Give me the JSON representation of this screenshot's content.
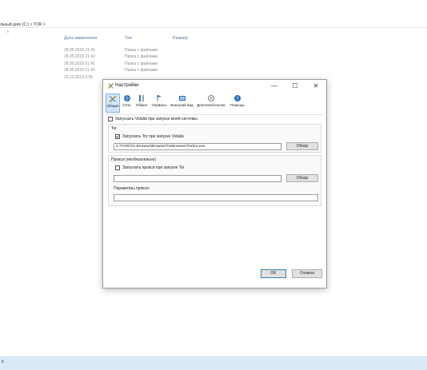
{
  "explorer": {
    "breadcrumb": "льный диск (C:)  >  TOR  >",
    "columns": {
      "date": "Дата изменения",
      "type": "Тип",
      "size": "Размер"
    },
    "rows": [
      {
        "date": "28.05.2019 21:41",
        "type": "Папка с файлами"
      },
      {
        "date": "28.05.2019 21:43",
        "type": "Папка с файлами"
      },
      {
        "date": "28.05.2019 21:41",
        "type": "Папка с файлами"
      },
      {
        "date": "28.05.2019 21:42",
        "type": "Папка с файлами"
      },
      {
        "date": "20.12.2013 0:05",
        "type": ""
      }
    ],
    "taskbar_item": "b"
  },
  "dialog": {
    "title": "Настройки",
    "window_buttons": {
      "minimize": "—",
      "maximize": "☐",
      "close": "✕"
    },
    "tabs": [
      {
        "label": "Общие",
        "icon": "general-icon",
        "color": "#c08a2c"
      },
      {
        "label": "Сеть",
        "icon": "network-icon",
        "color": "#2a6fb8"
      },
      {
        "label": "Обмен",
        "icon": "exchange-icon",
        "color": "#4d6e9b"
      },
      {
        "label": "Сервисы",
        "icon": "services-icon",
        "color": "#2a6fb8"
      },
      {
        "label": "Внешний вид",
        "icon": "appearance-icon",
        "color": "#2e6ebc"
      },
      {
        "label": "Дополнительное",
        "icon": "advanced-icon",
        "color": "#8e8e8e"
      },
      {
        "label": "Помощь",
        "icon": "help-icon",
        "color": "#2a6fb8"
      }
    ],
    "selected_tab": "Общие",
    "start_with_system": {
      "label": "Запускать Vidalia при запуске моей системы",
      "checked": false
    },
    "tor_group": {
      "title": "Tor",
      "start_tor": {
        "label": "Запускать Tor при запуске Vidalia",
        "checked": true
      },
      "path": "C:\\TOR\\Tor Browser\\Browser\\TorBrowser\\Tor\\tor.exe",
      "browse": "Обзор"
    },
    "proxy_group": {
      "title": "Прокси (необязательно)",
      "start_proxy": {
        "label": "Запускать прокси при запуске Tor",
        "checked": false
      },
      "path": "",
      "browse": "Обзор",
      "params_label": "Параметры прокси:",
      "params": ""
    },
    "ok": "OK",
    "cancel": "Отмена"
  }
}
